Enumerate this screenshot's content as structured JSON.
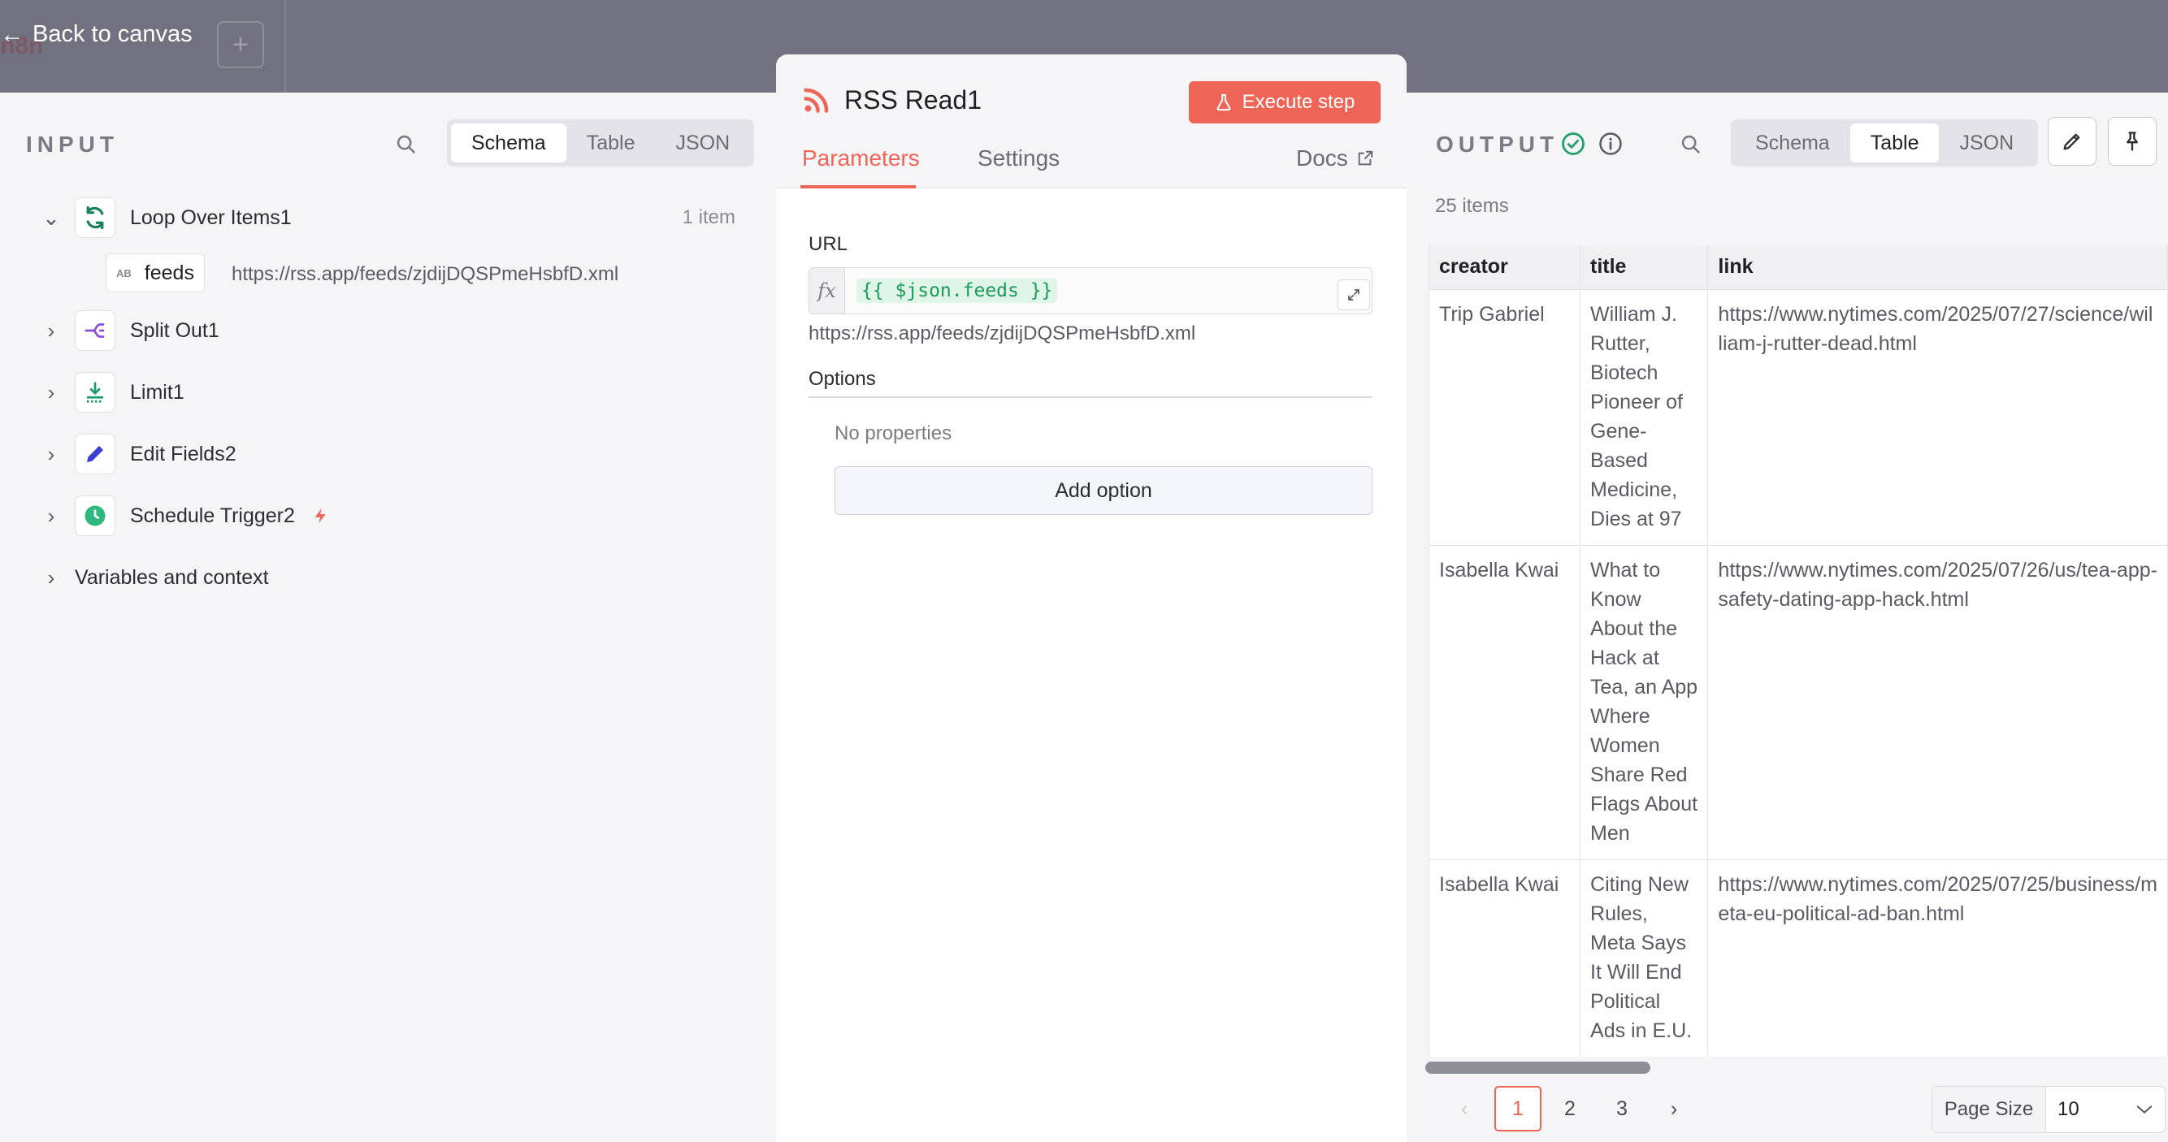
{
  "topbar": {
    "back_label": "Back to canvas",
    "plus_label": "+",
    "logo_text": "n8n"
  },
  "input": {
    "heading": "INPUT",
    "view_tabs": [
      "Schema",
      "Table",
      "JSON"
    ],
    "active_view": "Schema",
    "nodes": [
      {
        "label": "Loop Over Items1",
        "count": "1 item",
        "expanded": true,
        "icon": "loop-icon",
        "color": "#16835a"
      },
      {
        "label": "Split Out1",
        "expanded": false,
        "icon": "split-out-icon",
        "color": "#8b4fd8"
      },
      {
        "label": "Limit1",
        "expanded": false,
        "icon": "limit-icon",
        "color": "#1f9e6a"
      },
      {
        "label": "Edit Fields2",
        "expanded": false,
        "icon": "pencil-icon",
        "color": "#3b3fd6"
      },
      {
        "label": "Schedule Trigger2",
        "expanded": false,
        "icon": "clock-icon",
        "color": "#2fb981"
      }
    ],
    "field": {
      "type_badge": "AB",
      "name": "feeds",
      "value": "https://rss.app/feeds/zjdijDQSPmeHsbfD.xml"
    },
    "variables_label": "Variables and context"
  },
  "node": {
    "title": "RSS Read1",
    "execute_label": "Execute step",
    "tabs": [
      "Parameters",
      "Settings"
    ],
    "active_tab": "Parameters",
    "docs_label": "Docs",
    "url_label": "URL",
    "fx_label": "fx",
    "url_expression": "{{ $json.feeds }}",
    "url_resolved": "https://rss.app/feeds/zjdijDQSPmeHsbfD.xml",
    "options_label": "Options",
    "no_properties": "No properties",
    "add_option_label": "Add option",
    "accent_color": "#ee6557"
  },
  "output": {
    "heading": "OUTPUT",
    "view_tabs": [
      "Schema",
      "Table",
      "JSON"
    ],
    "active_view": "Table",
    "items_count": "25 items",
    "columns": [
      "creator",
      "title",
      "link"
    ],
    "rows": [
      {
        "creator": "Trip Gabriel",
        "title": "William J. Rutter, Biotech Pioneer of Gene-Based Medicine, Dies at 97",
        "link": "https://www.nytimes.com/2025/07/27/science/wil\nliam-j-rutter-dead.html"
      },
      {
        "creator": "Isabella Kwai",
        "title": "What to Know About the Hack at Tea, an App Where Women Share Red Flags About Men",
        "link": "https://www.nytimes.com/2025/07/26/us/tea-app-\nsafety-dating-app-hack.html"
      },
      {
        "creator": "Isabella Kwai",
        "title": "Citing New Rules, Meta Says It Will End Political Ads in E.U.",
        "link": "https://www.nytimes.com/2025/07/25/business/m\neta-eu-political-ad-ban.html"
      }
    ],
    "pagination": {
      "pages": [
        "1",
        "2",
        "3"
      ],
      "current": "1",
      "prev": "‹",
      "next": "›",
      "page_size_label": "Page Size",
      "page_size_value": "10"
    },
    "success_color": "#1f9e6a"
  }
}
